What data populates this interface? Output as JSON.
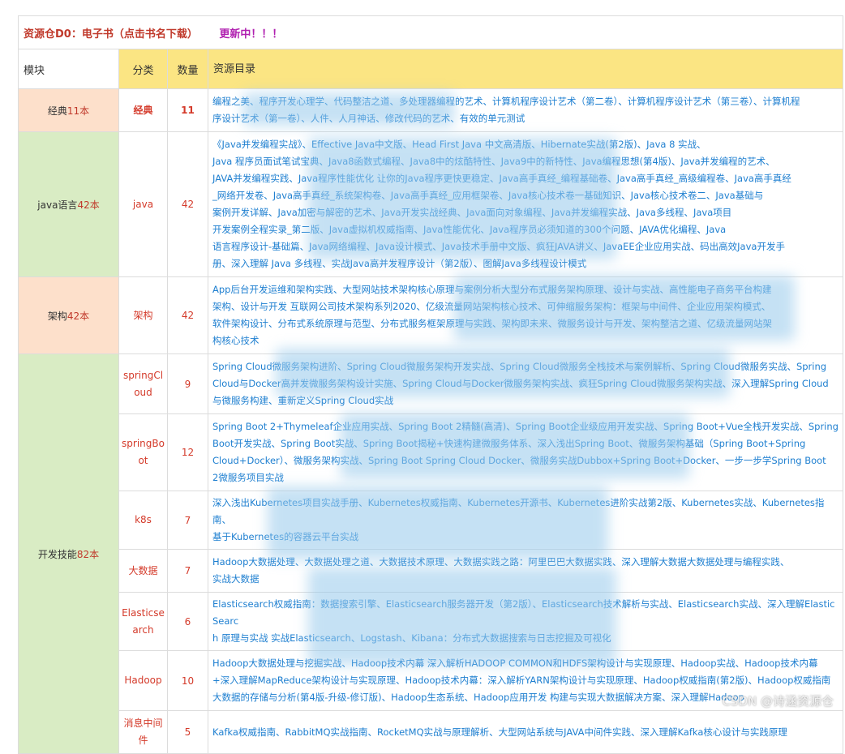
{
  "title": "资源仓D0：电子书（点击书名下载）",
  "updating": "更新中！！！",
  "headers": {
    "module": "模块",
    "category": "分类",
    "count": "数量",
    "resources": "资源目录"
  },
  "rows": [
    {
      "module": "经典",
      "module_count": "11本",
      "category": "经典",
      "count": "11",
      "resources": [
        "编程之美、程序开发心理学、代码整洁之道、多处理器编程的艺术、计算机程序设计艺术（第二卷）、计算机程序设计艺术（第三卷）、计算机程",
        "序设计艺术（第一卷）、人件、人月神话、修改代码的艺术、有效的单元测试"
      ]
    },
    {
      "module": "java语言",
      "module_count": "42本",
      "category": "java",
      "count": "42",
      "resources": [
        "《Java并发编程实战》、Effective Java中文版、Head First Java 中文高清版、Hibernate实战(第2版)、Java 8 实战、",
        "Java 程序员面试笔试宝典、Java8函数式编程、Java8中的炫酷特性、Java9中的新特性、Java编程思想(第4版)、Java并发编程的艺术、",
        "JAVA并发编程实践、Java程序性能优化 让你的Java程序更快更稳定、Java高手真经_编程基础卷、Java高手真经_高级编程卷、Java高手真经",
        "_网络开发卷、Java高手真经_系统架构卷、Java高手真经_应用框架卷、Java核心技术卷一基础知识、Java核心技术卷二、Java基础与",
        "案例开发详解、Java加密与解密的艺术、Java开发实战经典、Java面向对象编程、Java并发编程实战、Java多线程、Java项目",
        "开发案例全程实录_第二版、Java虚拟机权威指南、Java性能优化、Java程序员必须知道的300个问题、JAVA优化编程、Java",
        "语言程序设计-基础篇、Java网络编程、Java设计模式、Java技术手册中文版、疯狂JAVA讲义、JavaEE企业应用实战、码出高效Java开发手",
        "册、深入理解 Java 多线程、实战Java高并发程序设计（第2版）、图解Java多线程设计模式"
      ]
    },
    {
      "module": "架构",
      "module_count": "42本",
      "category": "架构",
      "count": "42",
      "resources": [
        "App后台开发运维和架构实践、大型网站技术架构核心原理与案例分析大型分布式服务架构原理、设计与实战、高性能电子商务平台构建",
        "架构、设计与开发 互联网公司技术架构系列2020、亿级流量网站架构核心技术、可伸缩服务架构：框架与中间件、企业应用架构模式、",
        "软件架构设计、分布式系统原理与范型、分布式服务框架原理与实践、架构即未来、微服务设计与开发、架构整洁之道、亿级流量网站架",
        "构核心技术"
      ]
    },
    {
      "module": "开发技能",
      "module_count": "82本",
      "category": "springCloud",
      "count": "9",
      "resources": [
        "Spring Cloud微服务架构进阶、Spring Cloud微服务架构开发实战、Spring Cloud微服务全栈技术与案例解析、Spring Cloud微服务实战、Spring",
        "Cloud与Docker高并发微服务架构设计实施、Spring Cloud与Docker微服务架构实战、疯狂Spring Cloud微服务架构实战、深入理解Spring Cloud",
        "与微服务构建、重新定义Spring Cloud实战"
      ]
    },
    {
      "category": "springBoot",
      "count": "12",
      "resources": [
        "Spring Boot 2+Thymeleaf企业应用实战、Spring Boot 2精髓(高清)、Spring Boot企业级应用开发实战、Spring Boot+Vue全栈开发实战、Spring",
        "Boot开发实战、Spring Boot实战、Spring Boot揭秘+快速构建微服务体系、深入浅出Spring Boot、微服务架构基础（Spring Boot+Spring",
        "Cloud+Docker）、微服务架构实战、Spring Boot Spring Cloud Docker、微服务实战Dubbox+Spring Boot+Docker、一步一步学Spring Boot",
        "2微服务项目实战"
      ]
    },
    {
      "category": "k8s",
      "count": "7",
      "resources": [
        "深入浅出Kubernetes项目实战手册、Kubernetes权威指南、Kubernetes开源书、Kubernetes进阶实战第2版、Kubernetes实战、Kubernetes指南、",
        "基于Kubernetes的容器云平台实战"
      ]
    },
    {
      "category": "大数据",
      "count": "7",
      "resources": [
        "Hadoop大数据处理、大数据处理之道、大数据技术原理、大数据实践之路：阿里巴巴大数据实践、深入理解大数据大数据处理与编程实践、",
        "实战大数据"
      ]
    },
    {
      "category": "Elasticsearch",
      "count": "6",
      "resources": [
        " Elasticsearch权威指南：数据搜索引擎、Elasticsearch服务器开发（第2版）、Elasticsearch技术解析与实战、Elasticsearch实战、深入理解ElasticSearc",
        "h 原理与实战 实战Elasticsearch、Logstash、Kibana：分布式大数据搜索与日志挖掘及可视化"
      ]
    },
    {
      "category": "Hadoop",
      "count": "10",
      "resources": [
        "Hadoop大数据处理与挖掘实战、Hadoop技术内幕 深入解析HADOOP COMMON和HDFS架构设计与实现原理、Hadoop实战、Hadoop技术内幕",
        "+深入理解MapReduce架构设计与实现原理、Hadoop技术内幕：深入解析YARN架构设计与实现原理、Hadoop权威指南(第2版)、Hadoop权威指南",
        "大数据的存储与分析(第4版-升级-修订版)、Hadoop生态系统、Hadoop应用开发 构建与实现大数据解决方案、深入理解Hadoop"
      ]
    },
    {
      "category": "消息中间件",
      "count": "5",
      "resources": [
        "Kafka权威指南、RabbitMQ实战指南、RocketMQ实战与原理解析、大型网站系统与JAVA中间件实践、深入理解Kafka核心设计与实践原理"
      ]
    }
  ],
  "watermark": "CSDN @诗涵资源仓"
}
